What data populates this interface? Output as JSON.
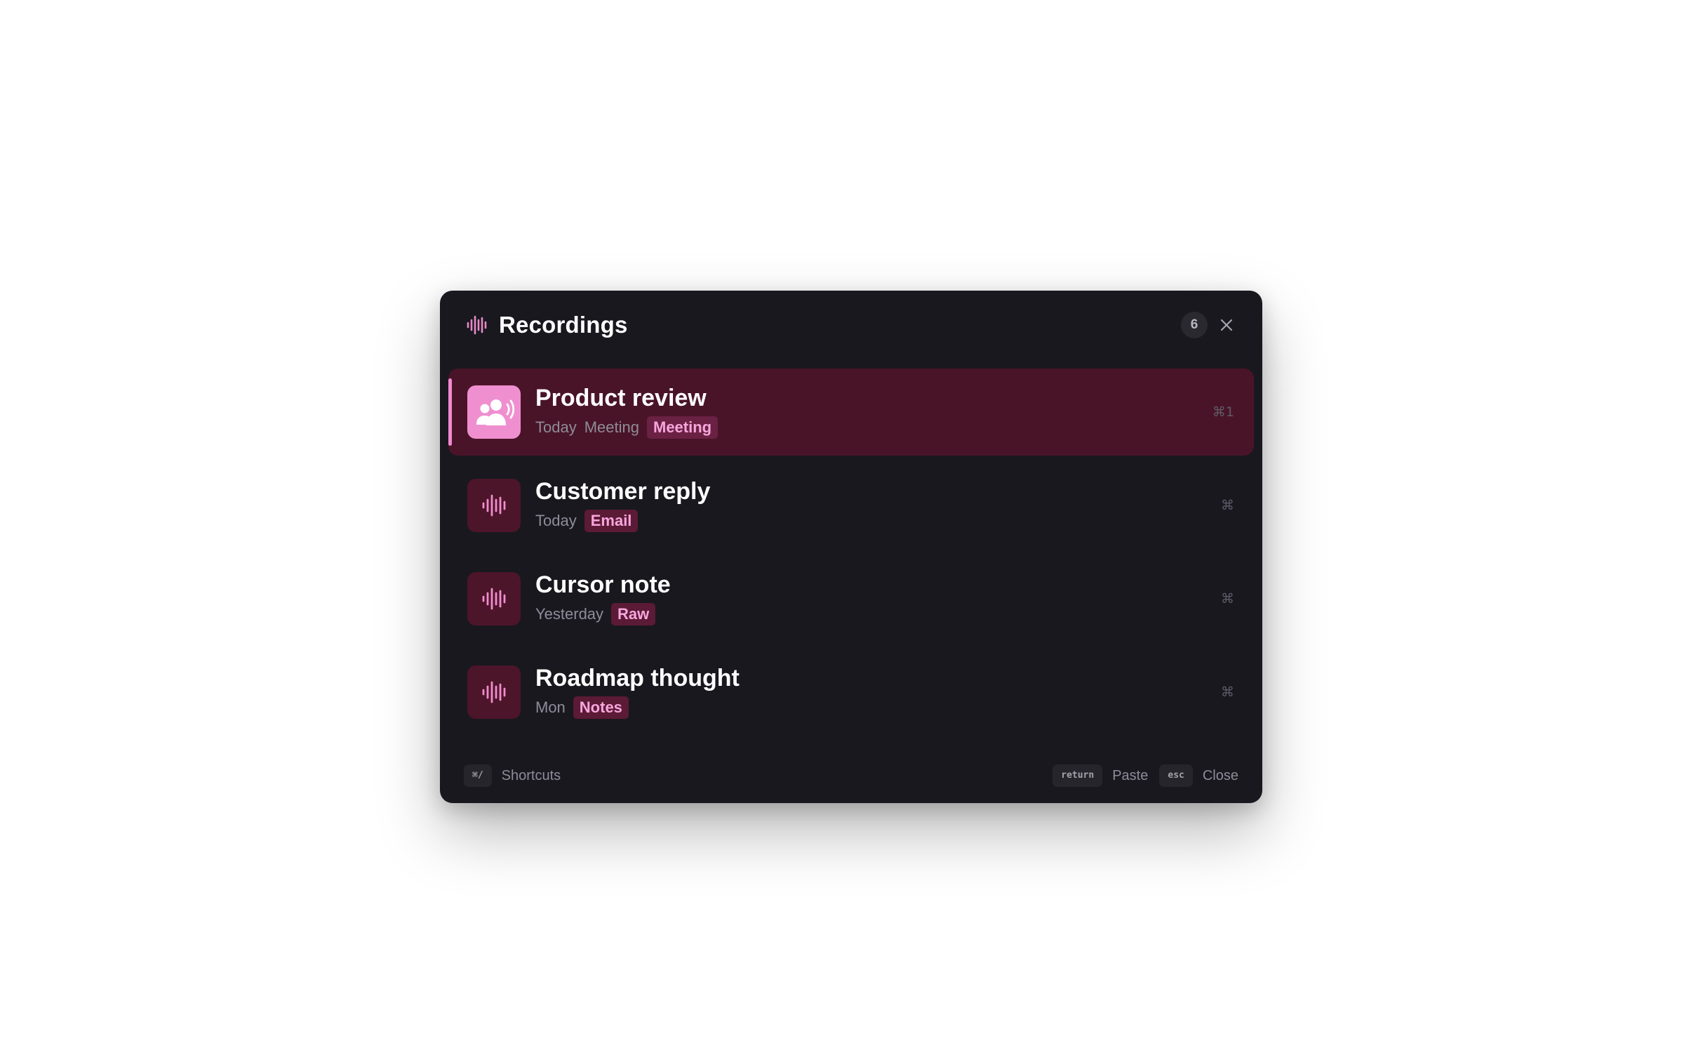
{
  "header": {
    "title": "Recordings",
    "count": "6",
    "logo_icon": "waveform-icon",
    "close_icon": "close-icon"
  },
  "colors": {
    "panel": "#19181f",
    "selected_row": "#4a1428",
    "accent": "#f28ad0",
    "tag_text": "#f7a6dc"
  },
  "recordings": [
    {
      "title": "Product review",
      "date": "Today",
      "kind": "Meeting",
      "tag": "Meeting",
      "shortcut": "⌘1",
      "icon": "people-speaking-icon",
      "selected": true
    },
    {
      "title": "Customer reply",
      "date": "Today",
      "tag": "Email",
      "shortcut": "⌘",
      "icon": "waveform-icon",
      "selected": false
    },
    {
      "title": "Cursor note",
      "date": "Yesterday",
      "tag": "Raw",
      "shortcut": "⌘",
      "icon": "waveform-icon",
      "selected": false
    },
    {
      "title": "Roadmap thought",
      "date": "Mon",
      "tag": "Notes",
      "shortcut": "⌘",
      "icon": "waveform-icon",
      "selected": false
    }
  ],
  "footer": {
    "shortcuts_key": "⌘/",
    "shortcuts_label": "Shortcuts",
    "paste_key": "return",
    "paste_label": "Paste",
    "close_key": "esc",
    "close_label": "Close"
  }
}
